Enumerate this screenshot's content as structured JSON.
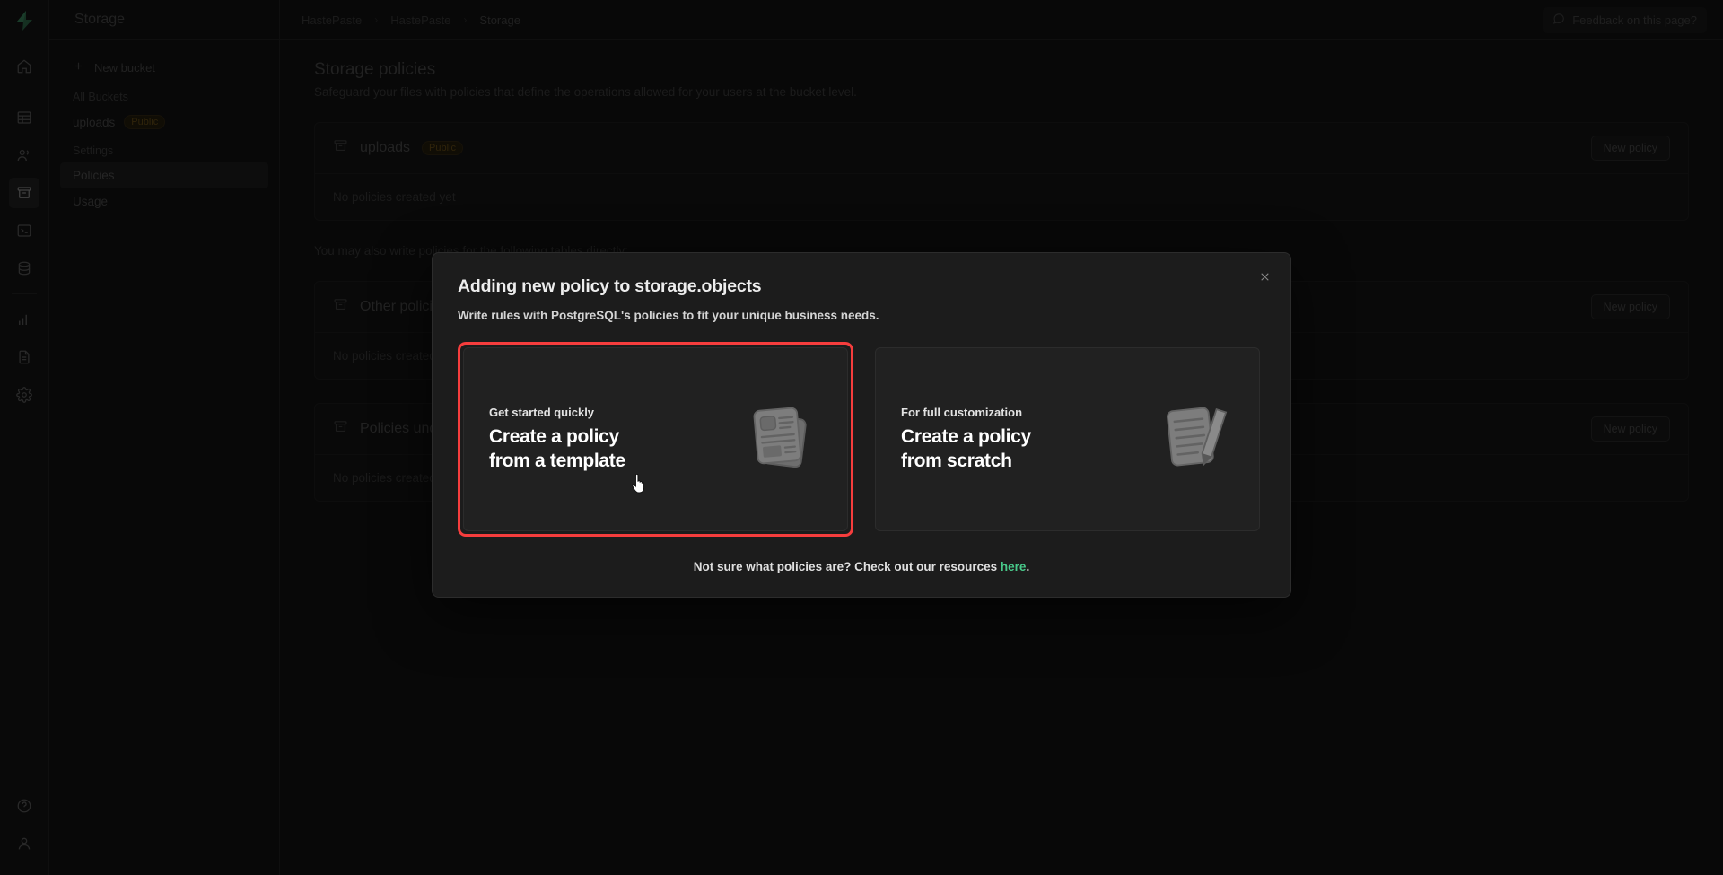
{
  "rail": {
    "logo_icon": "supabase-logo-icon",
    "items": [
      {
        "icon": "home-icon",
        "name": "home",
        "active": false
      },
      {
        "icon": "table-editor-icon",
        "name": "table-editor",
        "active": false
      },
      {
        "icon": "authentication-icon",
        "name": "authentication",
        "active": false
      },
      {
        "icon": "storage-icon",
        "name": "storage",
        "active": true
      },
      {
        "icon": "sql-editor-icon",
        "name": "sql-editor",
        "active": false
      },
      {
        "icon": "database-icon",
        "name": "database",
        "active": false
      },
      {
        "icon": "reports-icon",
        "name": "reports",
        "active": false
      },
      {
        "icon": "logs-icon",
        "name": "logs",
        "active": false
      },
      {
        "icon": "settings-gear-icon",
        "name": "settings",
        "active": false
      }
    ],
    "bottom": [
      {
        "icon": "help-circle-icon",
        "name": "help"
      },
      {
        "icon": "user-account-icon",
        "name": "account"
      }
    ]
  },
  "topbar": {
    "title": "Storage",
    "breadcrumb": [
      "HastePaste",
      "HastePaste",
      "Storage"
    ],
    "breadcrumb_separator": "›",
    "feedback_label": "Feedback on this page?",
    "feedback_icon": "chat-bubble-icon"
  },
  "sidebar": {
    "new_bucket_label": "New bucket",
    "new_bucket_icon": "plus-icon",
    "all_buckets_label": "All Buckets",
    "buckets": [
      {
        "name": "uploads",
        "badge": "Public"
      }
    ],
    "settings_label": "Settings",
    "settings_items": [
      {
        "label": "Policies",
        "selected": true
      },
      {
        "label": "Usage",
        "selected": false
      }
    ]
  },
  "main": {
    "title": "Storage policies",
    "subtitle": "Safeguard your files with policies that define the operations allowed for your users at the bucket level.",
    "bucket_icon": "bucket-icon",
    "new_policy_label": "New policy",
    "empty_text": "No policies created yet",
    "note": "You may also write policies for the following tables directly:",
    "panels": [
      {
        "name": "uploads",
        "badge": "Public",
        "empty": "No policies created yet"
      },
      {
        "name": "Other policies under storage.objects",
        "badge": "",
        "empty": "No policies created yet"
      },
      {
        "name": "Policies under storage.buckets",
        "badge": "",
        "empty": "No policies created yet"
      }
    ]
  },
  "modal": {
    "title": "Adding new policy to storage.objects",
    "subtitle": "Write rules with PostgreSQL's policies to fit your unique business needs.",
    "close_icon": "close-icon",
    "cards": [
      {
        "eyebrow": "Get started quickly",
        "heading_line1": "Create a policy",
        "heading_line2": "from a template",
        "art": "template-document-icon",
        "highlighted": true
      },
      {
        "eyebrow": "For full customization",
        "heading_line1": "Create a policy",
        "heading_line2": "from scratch",
        "art": "document-pencil-icon",
        "highlighted": false
      }
    ],
    "footer_text_before": "Not sure what policies are? Check out our resources ",
    "footer_link": "here",
    "footer_text_after": ".",
    "highlight_color": "#f63d3d",
    "link_color": "#48c98a"
  }
}
